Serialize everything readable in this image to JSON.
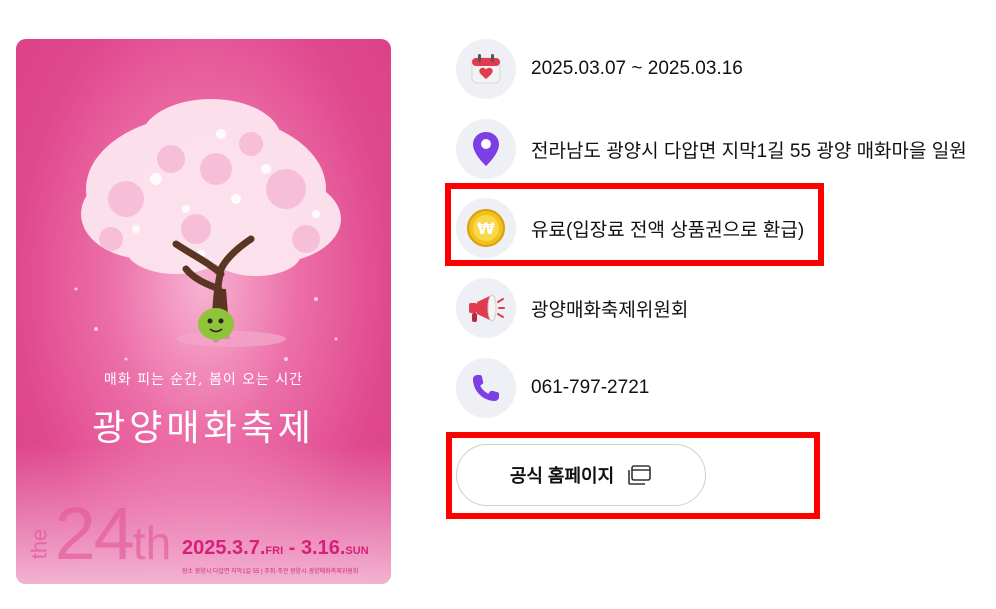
{
  "poster": {
    "subtitle": "매화 피는 순간, 봄이 오는 시간",
    "title": "광양매화축제",
    "edition_the": "the",
    "edition_num": "24",
    "edition_th": "th",
    "dates_main": "2025.3.7.",
    "dates_fri": "FRI",
    "dates_sep": " - ",
    "dates_end": "3.16.",
    "dates_sun": "SUN",
    "footer": "장소 광양시 다압면 지막1길 55 | 주최·주관 광양시·광양매화축제위원회"
  },
  "info": {
    "date": "2025.03.07 ~ 2025.03.16",
    "address": "전라남도 광양시 다압면 지막1길 55 광양 매화마을 일원",
    "fee": "유료(입장료 전액 상품권으로 환급)",
    "organizer": "광양매화축제위원회",
    "phone": "061-797-2721"
  },
  "homepage": {
    "label": "공식 홈페이지"
  },
  "icons": {
    "date": "calendar-heart-icon",
    "address": "location-pin-icon",
    "fee": "won-coin-icon",
    "organizer": "megaphone-icon",
    "phone": "phone-icon",
    "external": "new-window-icon"
  },
  "colors": {
    "poster_pink": "#e0488e",
    "highlight_red": "#ff0000",
    "icon_bg": "#eef0f5",
    "pin_purple": "#7b3fe4"
  }
}
